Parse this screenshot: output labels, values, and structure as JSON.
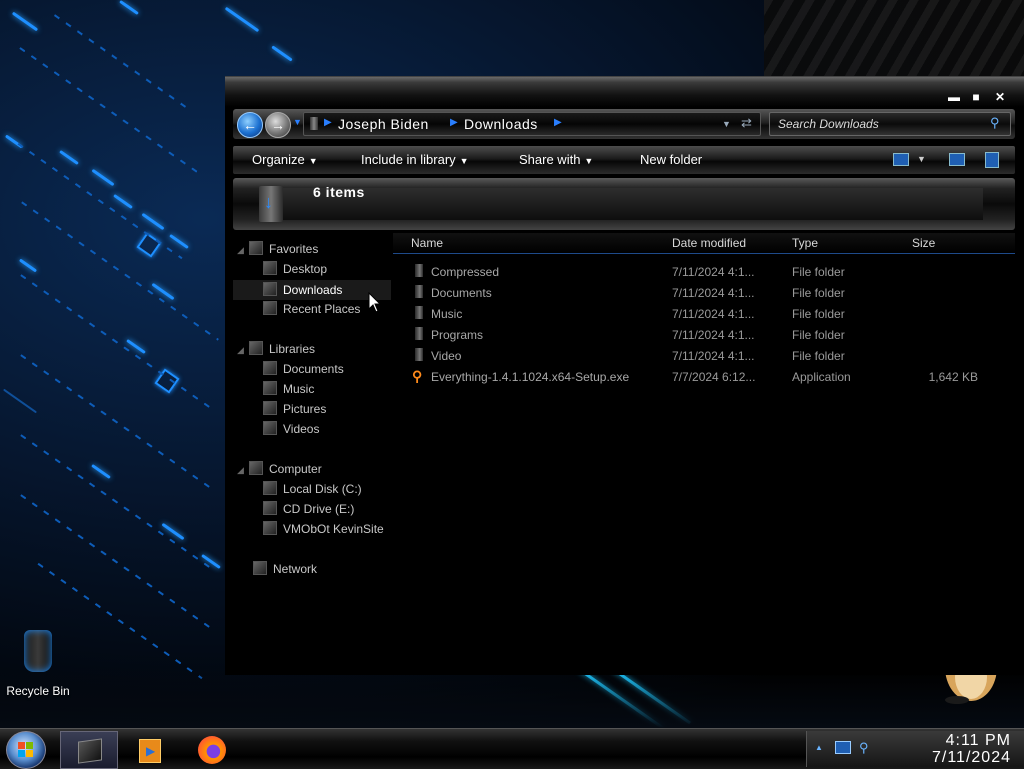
{
  "desktop": {
    "icons": [
      {
        "label": "Recycle Bin",
        "icon": "recycle-bin-icon"
      }
    ]
  },
  "window": {
    "controls": {
      "minimize": "▬",
      "maximize": "■",
      "close": "✕"
    },
    "address": {
      "crumbs": [
        "Joseph Biden",
        "Downloads"
      ],
      "search_placeholder": "Search Downloads"
    },
    "toolbar": {
      "organize": "Organize",
      "include_in_library": "Include in library",
      "share_with": "Share with",
      "new_folder": "New folder"
    },
    "details": {
      "items_count": "6 items"
    },
    "nav": {
      "favorites_header": "Favorites",
      "favorites": [
        "Desktop",
        "Downloads",
        "Recent Places"
      ],
      "libraries_header": "Libraries",
      "libraries": [
        "Documents",
        "Music",
        "Pictures",
        "Videos"
      ],
      "computer_header": "Computer",
      "computer": [
        "Local Disk (C:)",
        "CD Drive (E:)",
        "VMObOt KevinSite"
      ],
      "network": "Network",
      "selected": "Downloads"
    },
    "columns": {
      "name": "Name",
      "date": "Date modified",
      "type": "Type",
      "size": "Size"
    },
    "files": [
      {
        "name": "Compressed",
        "date": "7/11/2024 4:1...",
        "type": "File folder",
        "size": "",
        "icon": "folder-icon"
      },
      {
        "name": "Documents",
        "date": "7/11/2024 4:1...",
        "type": "File folder",
        "size": "",
        "icon": "folder-icon"
      },
      {
        "name": "Music",
        "date": "7/11/2024 4:1...",
        "type": "File folder",
        "size": "",
        "icon": "folder-icon"
      },
      {
        "name": "Programs",
        "date": "7/11/2024 4:1...",
        "type": "File folder",
        "size": "",
        "icon": "folder-icon"
      },
      {
        "name": "Video",
        "date": "7/11/2024 4:1...",
        "type": "File folder",
        "size": "",
        "icon": "folder-icon"
      },
      {
        "name": "Everything-1.4.1.1024.x64-Setup.exe",
        "date": "7/7/2024 6:12...",
        "type": "Application",
        "size": "1,642 KB",
        "icon": "magnifier-app-icon"
      }
    ]
  },
  "taskbar": {
    "clock_time": "4:11 PM",
    "clock_date": "7/11/2024",
    "pinned": [
      "windows-explorer-icon",
      "media-player-icon",
      "firefox-icon"
    ]
  },
  "colors": {
    "accent": "#1e8fff",
    "background": "#000000",
    "text": "#c8c8c8",
    "app_icon": "#ff8a1a"
  }
}
